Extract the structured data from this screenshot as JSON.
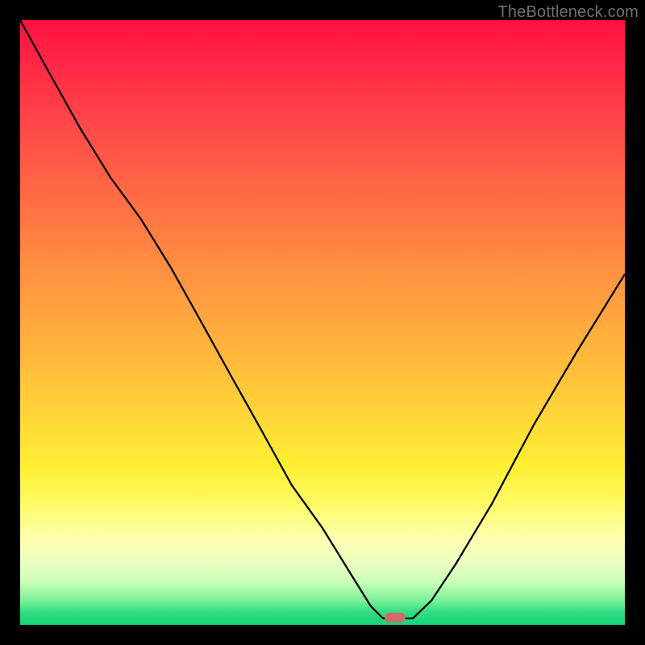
{
  "watermark": "TheBottleneck.com",
  "marker": {
    "x_frac": 0.62,
    "y_frac": 0.988
  },
  "chart_data": {
    "type": "line",
    "title": "",
    "xlabel": "",
    "ylabel": "",
    "xlim": [
      0,
      1
    ],
    "ylim": [
      0,
      1
    ],
    "grid": false,
    "legend": false,
    "x": [
      0.0,
      0.05,
      0.1,
      0.15,
      0.2,
      0.25,
      0.3,
      0.35,
      0.4,
      0.45,
      0.5,
      0.55,
      0.58,
      0.6,
      0.63,
      0.65,
      0.68,
      0.72,
      0.78,
      0.85,
      0.92,
      1.0
    ],
    "values": [
      1.0,
      0.91,
      0.82,
      0.74,
      0.67,
      0.59,
      0.5,
      0.41,
      0.32,
      0.23,
      0.16,
      0.08,
      0.03,
      0.01,
      0.01,
      0.01,
      0.04,
      0.1,
      0.2,
      0.33,
      0.45,
      0.58
    ],
    "annotations": [
      {
        "kind": "marker",
        "x": 0.62,
        "y": 0.012,
        "color": "#d36a6a",
        "shape": "pill"
      }
    ],
    "background_gradient_top_to_bottom": [
      "#ff1040",
      "#ff6e44",
      "#ffd838",
      "#fdffb3",
      "#18d57a"
    ]
  }
}
